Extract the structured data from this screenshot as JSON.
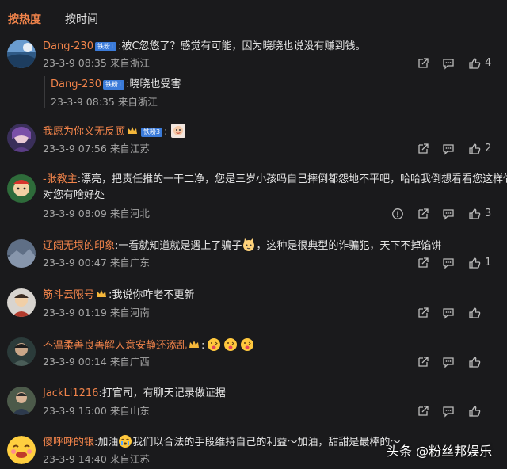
{
  "tabs": {
    "hot": "按热度",
    "time": "按时间"
  },
  "colors": {
    "accent": "#f0834a",
    "background": "#1a1a1c",
    "badge": "#3b7bd9"
  },
  "comments": [
    {
      "user": "Dang-230",
      "badge": "铁粉1",
      "text": ":被C忽悠了？感觉有可能，因为晓晓也说没有赚到钱。",
      "date": "23-3-9 08:35",
      "location": "来自浙江",
      "likes": "4"
    },
    {
      "user": "Dang-230",
      "badge": "铁粉1",
      "text": ":晓晓也受害",
      "date": "23-3-9 08:35",
      "location": "来自浙江",
      "is_reply": true
    },
    {
      "user": "我愿为你义无反顾",
      "badge": "铁粉3",
      "text": ":",
      "date": "23-3-9 07:56",
      "location": "来自江苏",
      "likes": "2"
    },
    {
      "user": "-张教主",
      "text": ":漂亮，把责任推的一干二净，您是三岁小孩吗自己摔倒都怨地不平吧，哈哈我倒想看看您这样做",
      "text2": "对您有啥好处",
      "date": "23-3-9 08:09",
      "location": "来自河北",
      "likes": "3"
    },
    {
      "user": "辽阔无垠的印象",
      "text": ":一看就知道就是遇上了骗子",
      "text_b": "，这种是很典型的诈骗犯，天下不掉馅饼",
      "date": "23-3-9 00:47",
      "location": "来自广东",
      "likes": "1"
    },
    {
      "user": "筋斗云限号",
      "text": ":我说你咋老不更新",
      "date": "23-3-9 01:19",
      "location": "来自河南"
    },
    {
      "user": "不温柔善良善解人意安静还添乱",
      "text": ":",
      "date": "23-3-9 00:14",
      "location": "来自广西"
    },
    {
      "user": "JackLi1216",
      "text": ":打官司，有聊天记录做证据",
      "date": "23-3-9 15:00",
      "location": "来自山东"
    },
    {
      "user": "傻呼呼的银",
      "text": ":加油",
      "text_b": "我们以合法的手段维持自己的利益～加油，甜甜是最棒的～",
      "date": "23-3-9 14:40",
      "location": "来自江苏"
    }
  ],
  "icons": {
    "share": "share-icon",
    "reply": "comment-icon",
    "like": "thumbs-up-icon",
    "report": "report-icon"
  },
  "watermark": "头条 @粉丝邦娱乐"
}
